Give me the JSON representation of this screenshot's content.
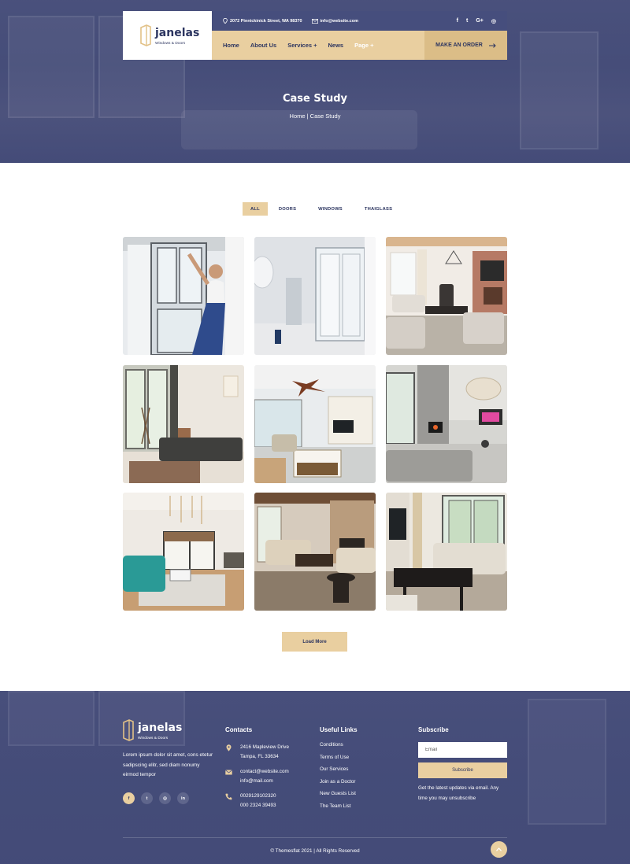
{
  "colors": {
    "accent": "#e9cfa0",
    "navy": "#2c3560",
    "overlay": "#404878"
  },
  "header": {
    "logo": {
      "name": "janelas",
      "tagline": "Windows & Doors"
    },
    "address": "2072 Pinnickinick Street, WA 98370",
    "email": "info@website.com",
    "social_icons": [
      "facebook-icon",
      "twitter-icon",
      "google-plus-icon",
      "instagram-icon"
    ],
    "social_glyphs": [
      "f",
      "t",
      "G+",
      "◎"
    ],
    "nav": {
      "home": "Home",
      "about": "About Us",
      "services": "Services +",
      "news": "News",
      "page": "Page +"
    },
    "order_button": "MAKE AN ORDER"
  },
  "hero": {
    "title": "Case Study",
    "breadcrumb": "Home | Case Study"
  },
  "filters": [
    "ALL",
    "DOORS",
    "WINDOWS",
    "THAIGLASS"
  ],
  "gallery_count": 9,
  "load_more": "Load More",
  "footer": {
    "logo": {
      "name": "janelas",
      "tagline": "Windows & Doors"
    },
    "about": "Lorem ipsum dolor sit amet, cons etetur sadipscing elitr, sed diam nonumy eirmod tempor",
    "social": [
      "f",
      "t",
      "◎",
      "in"
    ],
    "contacts": {
      "heading": "Contacts",
      "address_line1": "2416 Mapleview Drive",
      "address_line2": "Tampa, FL 33634",
      "email1": "contact@website.com",
      "email2": "info@mail.com",
      "phone1": "0029129102320",
      "phone2": "000 2324 39493"
    },
    "useful_links": {
      "heading": "Useful Links",
      "items": [
        "Conditions",
        "Terms of Use",
        "Our Services",
        "Join as a Doctor",
        "New Guests List",
        "The Team List"
      ]
    },
    "subscribe": {
      "heading": "Subscribe",
      "placeholder": "Email",
      "button": "Subscribe",
      "note": "Get the latest updates via email. Any time you may unsubscribe"
    },
    "copyright": "© Themesflat 2021 | All Rights Reserved"
  }
}
